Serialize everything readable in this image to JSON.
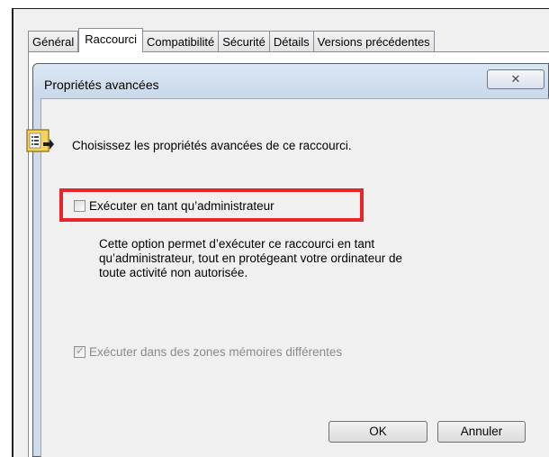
{
  "tabs": [
    "Général",
    "Raccourci",
    "Compatibilité",
    "Sécurité",
    "Détails",
    "Versions précédentes"
  ],
  "dialog": {
    "title": "Propriétés avancées",
    "close_symbol": "✕",
    "intro": "Choisissez les propriétés avancées de ce raccourci.",
    "run_as_admin": {
      "label": "Exécuter en tant qu’administrateur",
      "checked": false
    },
    "description_lines": [
      "Cette option permet d’exécuter ce raccourci en tant",
      "qu’administrateur, tout en protégeant votre ordinateur de",
      "toute activité non autorisée."
    ],
    "separate_memory": {
      "label": "Exécuter dans des zones mémoires différentes",
      "checked": true,
      "enabled": false
    },
    "ok_label": "OK",
    "cancel_label": "Annuler"
  },
  "colors": {
    "highlight": "#e8262a",
    "dialog_frame": "#cfdcec"
  }
}
